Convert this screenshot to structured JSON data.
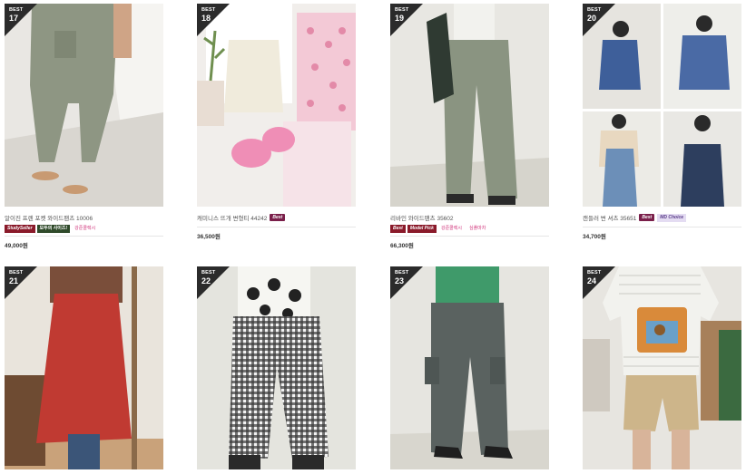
{
  "items": [
    {
      "best_label": "BEST",
      "rank": "17",
      "name": "알이진 프렌 포켓 와이드팬츠 10006",
      "best_badge": "",
      "badges": [
        {
          "text": "StudySeller",
          "cls": "b-red"
        },
        {
          "text": "모두의 사이즈!",
          "cls": "b-green"
        },
        {
          "text": "강준콜렉시",
          "cls": "b-pink"
        }
      ],
      "price": "49,000원"
    },
    {
      "best_label": "BEST",
      "rank": "18",
      "name": "캐미니스 뜨개 변형티 44242",
      "best_badge": "Best",
      "badges": [],
      "price": "36,500원"
    },
    {
      "best_label": "BEST",
      "rank": "19",
      "name": "리바인 와이드팬츠 35602",
      "best_badge": "",
      "badges": [
        {
          "text": "Best",
          "cls": "b-red"
        },
        {
          "text": "Model Pick",
          "cls": "b-red"
        },
        {
          "text": "강준콜렉시",
          "cls": "b-pink"
        },
        {
          "text": "심플마차",
          "cls": "b-pink"
        }
      ],
      "price": "66,300원"
    },
    {
      "best_label": "BEST",
      "rank": "20",
      "name": "캔들러 변 셔츠 35651",
      "best_badge": "Best",
      "badges": [
        {
          "text": "MD Choice",
          "cls": "b-lav"
        }
      ],
      "price": "34,700원"
    },
    {
      "best_label": "BEST",
      "rank": "21",
      "name": "",
      "best_badge": "",
      "badges": [],
      "price": ""
    },
    {
      "best_label": "BEST",
      "rank": "22",
      "name": "",
      "best_badge": "",
      "badges": [],
      "price": ""
    },
    {
      "best_label": "BEST",
      "rank": "23",
      "name": "",
      "best_badge": "",
      "badges": [],
      "price": ""
    },
    {
      "best_label": "BEST",
      "rank": "24",
      "name": "",
      "best_badge": "",
      "badges": [],
      "price": ""
    }
  ],
  "colors": {
    "rank_flag": "#2b2b2b",
    "best_badge": "#7a1f4a",
    "price_text": "#333333"
  }
}
